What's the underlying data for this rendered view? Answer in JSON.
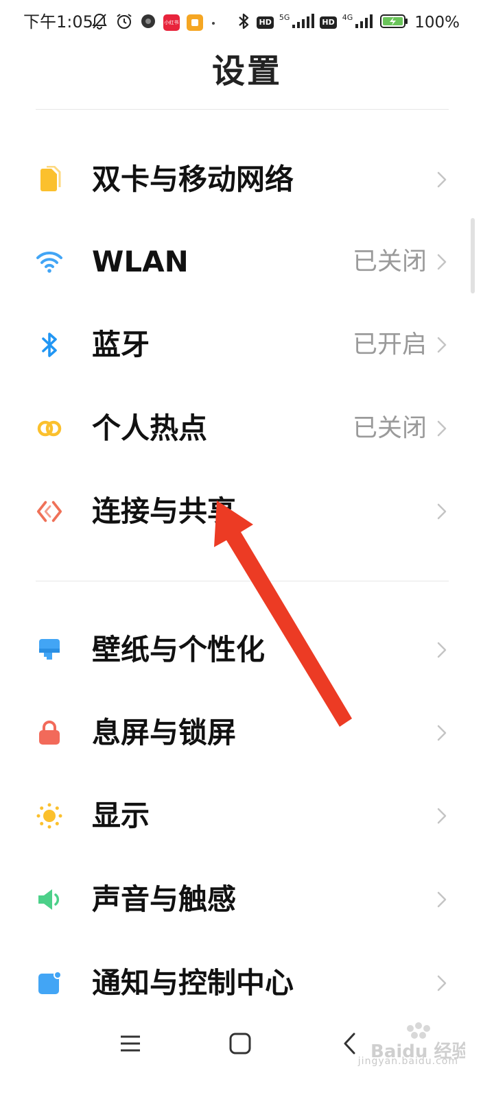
{
  "status_bar": {
    "time": "下午1:05",
    "network_1": "5G",
    "network_2": "4G",
    "hd_label": "HD",
    "mini_app_label": "小红书",
    "battery_percent": "100%",
    "icons": [
      "mute-bell-icon",
      "alarm-icon",
      "app-icon",
      "xiaohongshu-icon",
      "notes-icon",
      "dot-icon",
      "bluetooth-icon",
      "signal-icon",
      "battery-charging-icon"
    ]
  },
  "header": {
    "title": "设置"
  },
  "settings_groups": [
    {
      "items": [
        {
          "label": "双卡与移动网络",
          "status": "",
          "icon": "sim-card-icon",
          "color": "#fbc02d"
        },
        {
          "label": "WLAN",
          "status": "已关闭",
          "icon": "wifi-icon",
          "color": "#42a5f5"
        },
        {
          "label": "蓝牙",
          "status": "已开启",
          "icon": "bluetooth-icon",
          "color": "#2196f3"
        },
        {
          "label": "个人热点",
          "status": "已关闭",
          "icon": "hotspot-icon",
          "color": "#fbc02d"
        },
        {
          "label": "连接与共享",
          "status": "",
          "icon": "connection-share-icon",
          "color": "#ef7158"
        }
      ]
    },
    {
      "items": [
        {
          "label": "壁纸与个性化",
          "status": "",
          "icon": "wallpaper-icon",
          "color": "#42a5f5"
        },
        {
          "label": "息屏与锁屏",
          "status": "",
          "icon": "lock-icon",
          "color": "#f26a5a"
        },
        {
          "label": "显示",
          "status": "",
          "icon": "sun-icon",
          "color": "#fbc02d"
        },
        {
          "label": "声音与触感",
          "status": "",
          "icon": "speaker-icon",
          "color": "#4cd089"
        },
        {
          "label": "通知与控制中心",
          "status": "",
          "icon": "notification-icon",
          "color": "#42a5f5"
        }
      ]
    }
  ],
  "annotation": {
    "color": "#ec3b24"
  },
  "nav_bar": {
    "icons": [
      "menu-icon",
      "home-icon",
      "back-icon"
    ]
  },
  "watermark": {
    "text": "Baidu 经验",
    "subtext": "jingyan.baidu.com"
  }
}
